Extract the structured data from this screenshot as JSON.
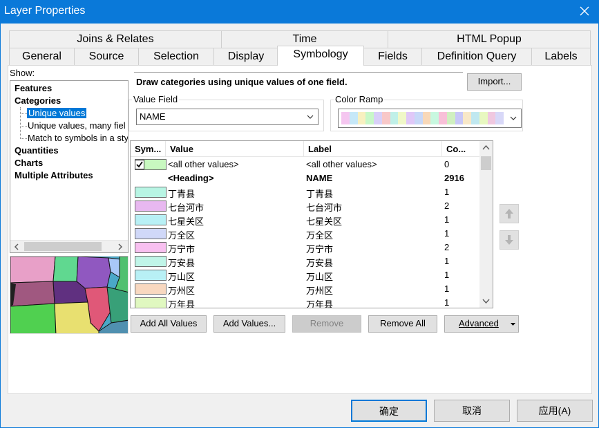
{
  "window": {
    "title": "Layer Properties"
  },
  "tabs_row1": [
    "Joins & Relates",
    "Time",
    "HTML Popup"
  ],
  "tabs_row2": [
    "General",
    "Source",
    "Selection",
    "Display",
    "Symbology",
    "Fields",
    "Definition Query",
    "Labels"
  ],
  "show": {
    "label": "Show:",
    "tree": [
      "Features",
      "Categories",
      "Unique values",
      "Unique values, many fiel",
      "Match to symbols in a sty",
      "Quantities",
      "Charts",
      "Multiple Attributes"
    ]
  },
  "description": "Draw categories using unique values of one field.",
  "import_label": "Import...",
  "value_field": {
    "caption": "Value Field",
    "value": "NAME"
  },
  "color_ramp": {
    "caption": "Color Ramp",
    "colors": [
      "#f5c6f0",
      "#c6e8f8",
      "#f8f0c0",
      "#c8f8c8",
      "#d8d0f8",
      "#f8c8c8",
      "#c0f0e8",
      "#f0f8c8",
      "#e0c8f8",
      "#c8d8f8",
      "#f8d8b8",
      "#c8f8e0",
      "#f8c0d8",
      "#d0f0c0",
      "#c8c8f8",
      "#f8e8c8",
      "#c0e8f0",
      "#e8f8c0",
      "#f0c8e0",
      "#d8d8f8"
    ]
  },
  "table": {
    "headers": {
      "symbol": "Sym...",
      "value": "Value",
      "label": "Label",
      "count": "Co..."
    },
    "rows": [
      {
        "color": "#c8f8c0",
        "value": "<all other values>",
        "label": "<all other values>",
        "count": "0"
      },
      {
        "value": "<Heading>",
        "label": "NAME",
        "count": "2916"
      },
      {
        "color": "#b8f5e4",
        "value": "丁青县",
        "label": "丁青县",
        "count": "1"
      },
      {
        "color": "#e8b8f0",
        "value": "七台河市",
        "label": "七台河市",
        "count": "2"
      },
      {
        "color": "#b8f0f5",
        "value": "七星关区",
        "label": "七星关区",
        "count": "1"
      },
      {
        "color": "#d0d8f8",
        "value": "万全区",
        "label": "万全区",
        "count": "1"
      },
      {
        "color": "#f8c0f0",
        "value": "万宁市",
        "label": "万宁市",
        "count": "2"
      },
      {
        "color": "#c0f5e8",
        "value": "万安县",
        "label": "万安县",
        "count": "1"
      },
      {
        "color": "#b8f0f5",
        "value": "万山区",
        "label": "万山区",
        "count": "1"
      },
      {
        "color": "#f8d8c0",
        "value": "万州区",
        "label": "万州区",
        "count": "1"
      },
      {
        "color": "#e0f8c0",
        "value": "万年县",
        "label": "万年县",
        "count": "1"
      }
    ]
  },
  "buttons": {
    "add_all": "Add All Values",
    "add_values": "Add Values...",
    "remove": "Remove",
    "remove_all": "Remove All",
    "advanced": "Advanced"
  },
  "footer": {
    "ok": "确定",
    "cancel": "取消",
    "apply": "应用(A)"
  }
}
